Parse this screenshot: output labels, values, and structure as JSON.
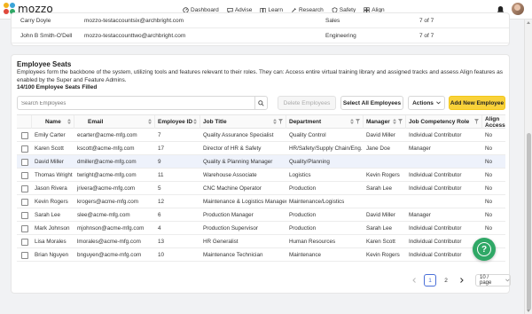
{
  "brand": {
    "name": "mozzo"
  },
  "nav": [
    {
      "label": "Dashboard",
      "icon": "dashboard-icon"
    },
    {
      "label": "Advise",
      "icon": "advise-icon"
    },
    {
      "label": "Learn",
      "icon": "learn-icon"
    },
    {
      "label": "Research",
      "icon": "research-icon"
    },
    {
      "label": "Safety",
      "icon": "safety-icon"
    },
    {
      "label": "Align",
      "icon": "align-icon"
    }
  ],
  "prev_rows": [
    {
      "name": "Carry Doyle",
      "email": "mozzo-testaccountsix@archbright.com",
      "dept": "Sales",
      "count": "7 of 7"
    },
    {
      "name": "John B Smith-O'Dell",
      "email": "mozzo-testaccounttwo@archbright.com",
      "dept": "Engineering",
      "count": "7 of 7"
    }
  ],
  "seats": {
    "title": "Employee Seats",
    "description": "Employees form the backbone of the system, utilizing tools and features relevant to their roles. They can: Access entire virtual training library and assigned tracks and assess Align features as enabled by the Super and Feature Admins.",
    "filled": "14/100 Employee Seats Filled",
    "search_placeholder": "Search Employees",
    "delete_label": "Delete Employees",
    "select_all_label": "Select All Employees",
    "actions_label": "Actions",
    "add_label": "Add New Employee"
  },
  "columns": [
    "Name",
    "Email",
    "Employee ID",
    "Job Title",
    "Department",
    "Manager",
    "Job Competency Role",
    "Align Access"
  ],
  "rows": [
    {
      "name": "Emily Carter",
      "email": "ecarter@acme-mfg.com",
      "id": "7",
      "title": "Quality Assurance Specialist",
      "dept": "Quality Control",
      "manager": "David Miller",
      "role": "Individual Contributor",
      "align": "No"
    },
    {
      "name": "Karen Scott",
      "email": "kscott@acme-mfg.com",
      "id": "17",
      "title": "Director of HR & Safety",
      "dept": "HR/Safety/Supply Chain/Eng.",
      "manager": "Jane Doe",
      "role": "Manager",
      "align": "No"
    },
    {
      "name": "David Miller",
      "email": "dmiller@acme-mfg.com",
      "id": "9",
      "title": "Quality & Planning Manager",
      "dept": "Quality/Planning",
      "manager": "",
      "role": "",
      "align": "No"
    },
    {
      "name": "Thomas Wright",
      "email": "twright@acme-mfg.com",
      "id": "11",
      "title": "Warehouse Associate",
      "dept": "Logistics",
      "manager": "Kevin Rogers",
      "role": "Individual Contributor",
      "align": "No"
    },
    {
      "name": "Jason Rivera",
      "email": "jrivera@acme-mfg.com",
      "id": "5",
      "title": "CNC Machine Operator",
      "dept": "Production",
      "manager": "Sarah Lee",
      "role": "Individual Contributor",
      "align": "No"
    },
    {
      "name": "Kevin Rogers",
      "email": "krogers@acme-mfg.com",
      "id": "12",
      "title": "Maintenance & Logistics Manager",
      "dept": "Maintenance/Logistics",
      "manager": "",
      "role": "",
      "align": "No"
    },
    {
      "name": "Sarah Lee",
      "email": "slee@acme-mfg.com",
      "id": "6",
      "title": "Production Manager",
      "dept": "Production",
      "manager": "David Miller",
      "role": "Manager",
      "align": "No"
    },
    {
      "name": "Mark Johnson",
      "email": "mjohnson@acme-mfg.com",
      "id": "4",
      "title": "Production Supervisor",
      "dept": "Production",
      "manager": "Sarah Lee",
      "role": "Individual Contributor",
      "align": "No"
    },
    {
      "name": "Lisa Morales",
      "email": "lmorales@acme-mfg.com",
      "id": "13",
      "title": "HR Generalist",
      "dept": "Human Resources",
      "manager": "Karen Scott",
      "role": "Individual Contributor",
      "align": "No"
    },
    {
      "name": "Brian Nguyen",
      "email": "bnguyen@acme-mfg.com",
      "id": "10",
      "title": "Maintenance Technician",
      "dept": "Maintenance",
      "manager": "Kevin Rogers",
      "role": "Individual Contributor",
      "align": "No"
    }
  ],
  "pagination": {
    "pages": [
      "1",
      "2"
    ],
    "per_page": "10 / page"
  },
  "colors": {
    "accent": "#f9d23a",
    "help": "#2fa866",
    "highlight_row": "#eef2fb"
  }
}
